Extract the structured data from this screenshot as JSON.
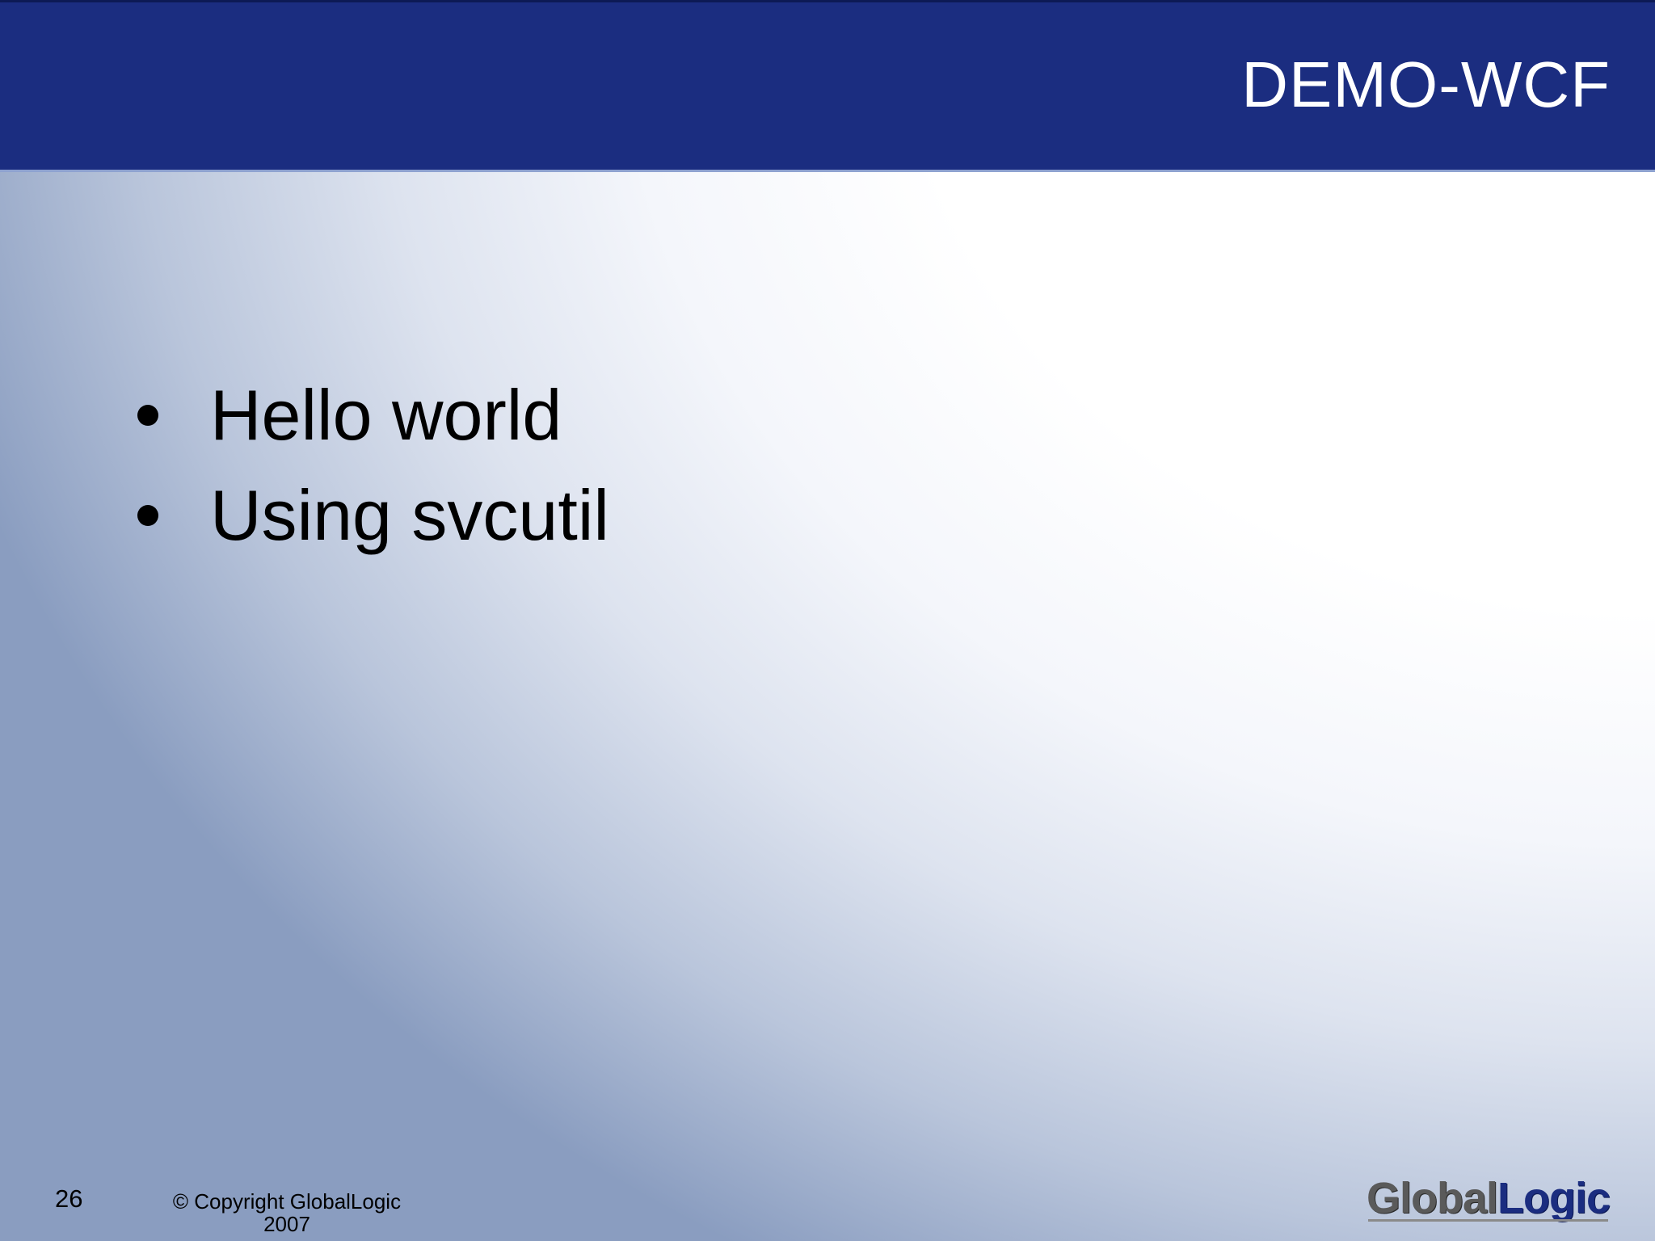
{
  "slide": {
    "title": "DEMO-WCF",
    "bullets": [
      "Hello world",
      "Using svcutil"
    ]
  },
  "footer": {
    "page_number": "26",
    "copyright_line1": "© Copyright GlobalLogic",
    "copyright_line2": "2007"
  },
  "logo": {
    "part_a": "Global",
    "part_b": "Logic",
    "colors": {
      "part_a": "#5a5a5a",
      "part_b": "#1b2d80"
    }
  },
  "colors": {
    "header_bar": "#1b2d80",
    "title_text": "#ffffff",
    "body_text": "#000000"
  }
}
